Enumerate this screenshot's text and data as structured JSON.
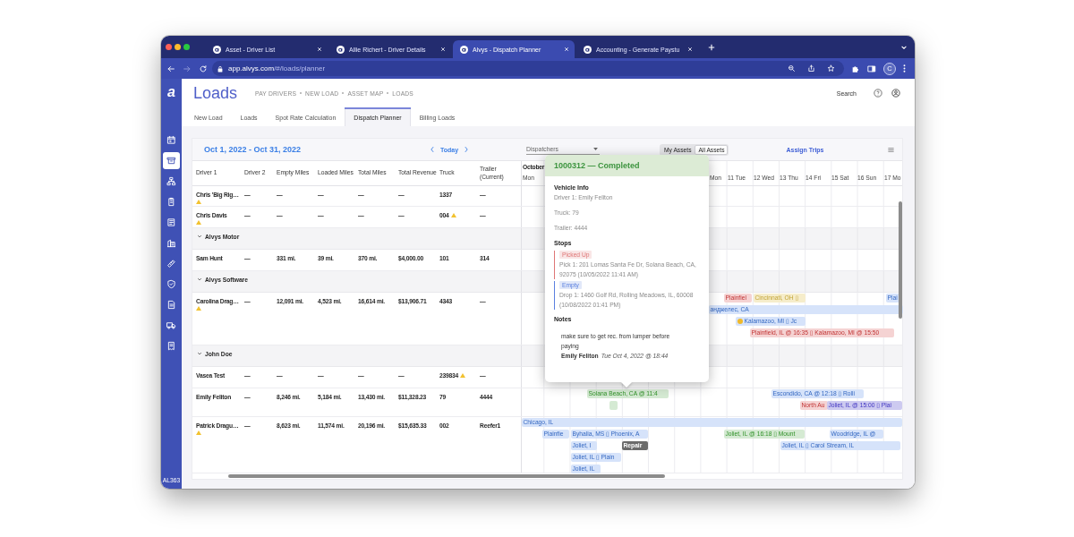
{
  "browser": {
    "tabs": [
      {
        "title": "Asset - Driver List",
        "selected": false
      },
      {
        "title": "Allie Richert - Driver Details",
        "selected": false
      },
      {
        "title": "Alvys - Dispatch Planner",
        "selected": true
      },
      {
        "title": "Accounting - Generate Paystu",
        "selected": false
      }
    ],
    "forward_disabled": true,
    "url": {
      "host": "app.alvys.com",
      "path": "/#/loads/planner"
    },
    "profile": "C"
  },
  "sidebar": {
    "logo": "a",
    "items": [
      {
        "selected": false
      },
      {
        "selected": true
      },
      {
        "selected": false
      },
      {
        "selected": false
      },
      {
        "selected": false
      },
      {
        "selected": false
      },
      {
        "selected": false
      },
      {
        "selected": false
      },
      {
        "selected": false
      },
      {
        "selected": false
      },
      {
        "selected": false
      }
    ],
    "footer": "AL363"
  },
  "header": {
    "title": "Loads",
    "breadcrumbs": [
      "PAY DRIVERS",
      "NEW LOAD",
      "ASSET MAP",
      "LOADS"
    ],
    "search": "Search"
  },
  "tabs": [
    {
      "label": "New Load",
      "selected": false
    },
    {
      "label": "Loads",
      "selected": false
    },
    {
      "label": "Spot Rate Calculation",
      "selected": false
    },
    {
      "label": "Dispatch Planner",
      "selected": true
    },
    {
      "label": "Billing Loads",
      "selected": false
    }
  ],
  "planner": {
    "date_range": "Oct 1, 2022 - Oct 31, 2022",
    "today": "Today",
    "dispatchers": {
      "placeholder": "Dispatchers"
    },
    "asset_filter": [
      {
        "label": "My Assets",
        "selected": false
      },
      {
        "label": "All Assets",
        "selected": true
      }
    ],
    "assign_trips": "Assign Trips",
    "columns": [
      "Driver 1",
      "Driver 2",
      "Empty Miles",
      "Loaded Miles",
      "Total Miles",
      "Total Revenue",
      "Truck",
      "Trailer (Current)"
    ],
    "month": "October",
    "days": [
      "Mon",
      "Mon",
      "11 Tue",
      "12 Wed",
      "13 Thu",
      "14 Fri",
      "15 Sat",
      "16 Sun",
      "17 Mo"
    ],
    "rows": [
      {
        "kind": "driver",
        "cells": [
          "Chris 'Big Rig…",
          "—",
          "—",
          "—",
          "—",
          "—",
          "1337",
          "—"
        ],
        "driver_warning": true,
        "truck_warning": false
      },
      {
        "kind": "driver",
        "cells": [
          "Chris Davis",
          "—",
          "—",
          "—",
          "—",
          "—",
          "004",
          "—"
        ],
        "driver_warning": true,
        "truck_warning": true
      },
      {
        "kind": "group",
        "name": "Alvys Motor",
        "expanded": true
      },
      {
        "kind": "driver",
        "cells": [
          "Sam Hunt",
          "—",
          "331 mi.",
          "39 mi.",
          "370 mi.",
          "$4,000.00",
          "101",
          "314"
        ],
        "driver_warning": false,
        "truck_warning": false
      },
      {
        "kind": "group",
        "name": "Alvys Software",
        "expanded": true
      },
      {
        "kind": "driver",
        "cells": [
          "Carolina Drag…",
          "—",
          "12,091 mi.",
          "4,523 mi.",
          "16,614 mi.",
          "$13,906.71",
          "4343",
          "—"
        ],
        "driver_warning": true,
        "truck_warning": false,
        "events": [
          {
            "kind": "trip",
            "label": "Plainfiel",
            "color": "#f5d3d3",
            "alert": false
          },
          {
            "kind": "trip",
            "label": "Cincinnati, OH ▯",
            "color": "#f6edcb",
            "alert": false
          },
          {
            "kind": "trip",
            "label": "Plai",
            "color": "#d6e3fa",
            "alert": false
          },
          {
            "kind": "trip",
            "label": "анджелес, CA",
            "color": "#d6e3fa",
            "alert": false
          },
          {
            "kind": "trip",
            "label": "Kalamazoo, MI ▯ Jc",
            "color": "#d6e3fa",
            "alert": true
          },
          {
            "kind": "trip",
            "label": "Plainfield, IL @ 16:35 ▯ Kalamazoo, MI @ 15:50",
            "color": "#f5d3d3",
            "alert": false
          }
        ]
      },
      {
        "kind": "group",
        "name": "John Doe",
        "expanded": true
      },
      {
        "kind": "driver",
        "cells": [
          "Vasea Test",
          "—",
          "—",
          "—",
          "—",
          "—",
          "239834",
          "—"
        ],
        "driver_warning": false,
        "truck_warning": true
      },
      {
        "kind": "driver",
        "cells": [
          "Emily Feliton",
          "—",
          "8,246 mi.",
          "5,184 mi.",
          "13,430 mi.",
          "$11,328.23",
          "79",
          "4444"
        ],
        "driver_warning": false,
        "truck_warning": false,
        "events": [
          {
            "kind": "trip",
            "label": "Solana Beach, CA @ 11:4",
            "color": "#d5ead3",
            "alert": false
          },
          {
            "kind": "trip",
            "color": "#d5ead3",
            "alert": false
          },
          {
            "kind": "trip",
            "label": "Escondido, CA @ 12:18 ▯ Rolli",
            "color": "#d6e3fa",
            "alert": false
          },
          {
            "kind": "trip",
            "label": "North Au",
            "color": "#f5d3d3",
            "alert": false
          },
          {
            "kind": "trip",
            "label": "Joliet, IL @ 15:00 ▯ Plai",
            "color": "#cdcaf0",
            "alert": false
          }
        ]
      },
      {
        "kind": "driver",
        "cells": [
          "Patrick Dragu…",
          "—",
          "8,623 mi.",
          "11,574 mi.",
          "20,196 mi.",
          "$15,635.33",
          "002",
          "Reefer1"
        ],
        "driver_warning": true,
        "truck_warning": false,
        "events": [
          {
            "kind": "trip",
            "label": "Chicago, IL",
            "color": "#d6e3fa",
            "alert": false
          },
          {
            "kind": "trip",
            "label": "Plainfie",
            "color": "#d6e3fa",
            "alert": false
          },
          {
            "kind": "trip",
            "label": "Byhalia, MS ▯ Phoenix, A",
            "color": "#d6e3fa",
            "alert": false
          },
          {
            "kind": "trip",
            "label": "Joliet, IL @ 16:18 ▯ Mount",
            "color": "#d5ead3",
            "alert": false
          },
          {
            "kind": "trip",
            "label": "Woodridge, IL @",
            "color": "#d6e3fa",
            "alert": false
          },
          {
            "kind": "trip",
            "label": "Joliet, I",
            "color": "#d6e3fa",
            "alert": false
          },
          {
            "kind": "repair",
            "label": "Repair",
            "color": "#6b6b6b",
            "alert": false
          },
          {
            "kind": "trip",
            "label": "Joliet, IL ▯ Carol Stream, IL",
            "color": "#d6e3fa",
            "alert": false
          },
          {
            "kind": "trip",
            "label": "Joliet, IL ▯ Plain",
            "color": "#d6e3fa",
            "alert": false
          },
          {
            "kind": "trip",
            "label": "Joliet, IL",
            "color": "#d6e3fa",
            "alert": false
          }
        ]
      }
    ]
  },
  "popover": {
    "title": "1000312 — Completed",
    "vehicle": {
      "heading": "Vehicle Info",
      "lines": [
        "Driver 1: Emily Feliton",
        "Truck: 79",
        "Trailer: 4444"
      ]
    },
    "stops": {
      "heading": "Stops",
      "items": [
        {
          "status": "Picked Up",
          "color": "#df7676",
          "text": "Pick 1: 201 Lomas Santa Fe Dr, Solana Beach, CA, 92075 (10/05/2022 11:41 AM)"
        },
        {
          "status": "Empty",
          "color": "#5b80e0",
          "text": "Drop 1: 1460 Golf Rd, Rolling Meadows, IL, 60008 (10/08/2022 01:41 PM)"
        }
      ]
    },
    "notes": {
      "heading": "Notes",
      "items": [
        {
          "text": "make sure to get rec. from lumper before paying",
          "author": "Emily Feliton",
          "time": "Tue Oct 4, 2022 @ 18:44"
        }
      ]
    }
  }
}
